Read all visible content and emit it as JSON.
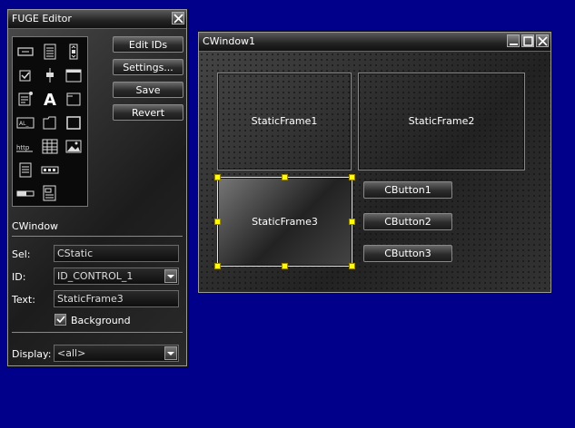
{
  "editor": {
    "title": "FUGE Editor",
    "buttons": {
      "edit_ids": "Edit IDs",
      "settings": "Settings...",
      "save": "Save",
      "revert": "Revert"
    },
    "window_label": "CWindow",
    "sel_label": "Sel:",
    "sel_value": "CStatic",
    "id_label": "ID:",
    "id_value": "ID_CONTROL_1",
    "text_label": "Text:",
    "text_value": "StaticFrame3",
    "background_label": "Background",
    "background_checked": true,
    "display_label": "Display:",
    "display_value": "<all>",
    "palette_icons": [
      "button-icon",
      "listbox-icon",
      "scrollbar-icon",
      "checkbox-icon",
      "slider-icon",
      "window-icon",
      "editbox-icon",
      "static-text-icon",
      "frame-icon",
      "label-icon",
      "tab-icon",
      "panel-icon",
      "hyperlink-icon",
      "grid-icon",
      "image-icon",
      "document-icon",
      "spinner-icon",
      "frame-icon",
      "progress-icon",
      "dialog-icon"
    ]
  },
  "cwindow": {
    "title": "CWindow1",
    "frames": [
      "StaticFrame1",
      "StaticFrame2",
      "StaticFrame3"
    ],
    "buttons": [
      "CButton1",
      "CButton2",
      "CButton3"
    ]
  },
  "colors": {
    "desktop": "#00008b",
    "selection": "#ffff00"
  }
}
